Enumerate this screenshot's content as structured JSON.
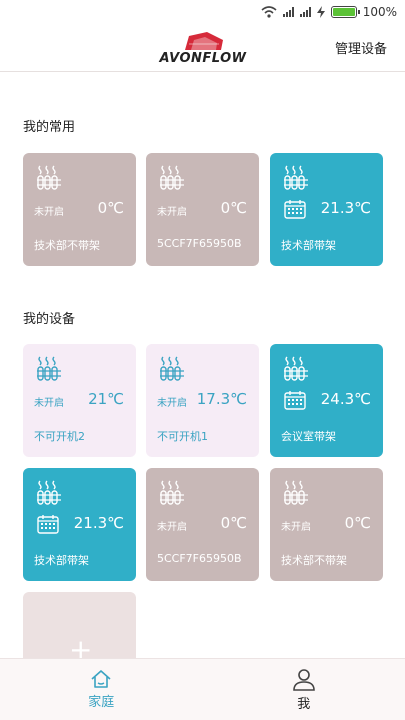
{
  "status_bar": {
    "battery_text": "100%"
  },
  "header": {
    "logo_text": "AVONFLOW",
    "manage_label": "管理设备"
  },
  "sections": {
    "favorites_title": "我的常用",
    "devices_title": "我的设备"
  },
  "favorites": [
    {
      "status": "未开启",
      "temp": "0℃",
      "name": "技术部不带架",
      "state": "off"
    },
    {
      "status": "未开启",
      "temp": "0℃",
      "name": "5CCF7F65950B",
      "state": "off"
    },
    {
      "status": "",
      "temp": "21.3℃",
      "name": "技术部带架",
      "state": "on"
    }
  ],
  "devices": [
    {
      "status": "未开启",
      "temp": "21℃",
      "name": "不可开机2",
      "state": "light"
    },
    {
      "status": "未开启",
      "temp": "17.3℃",
      "name": "不可开机1",
      "state": "light"
    },
    {
      "status": "",
      "temp": "24.3℃",
      "name": "会议室带架",
      "state": "on"
    },
    {
      "status": "",
      "temp": "21.3℃",
      "name": "技术部带架",
      "state": "on"
    },
    {
      "status": "未开启",
      "temp": "0℃",
      "name": "5CCF7F65950B",
      "state": "off"
    },
    {
      "status": "未开启",
      "temp": "0℃",
      "name": "技术部不带架",
      "state": "off"
    }
  ],
  "add_card": {
    "icon": "plus-icon"
  },
  "tabbar": {
    "home_label": "家庭",
    "me_label": "我"
  },
  "colors": {
    "accent": "#30afc8",
    "off_card": "#c8b8b7",
    "light_card": "#f6ecf6"
  }
}
